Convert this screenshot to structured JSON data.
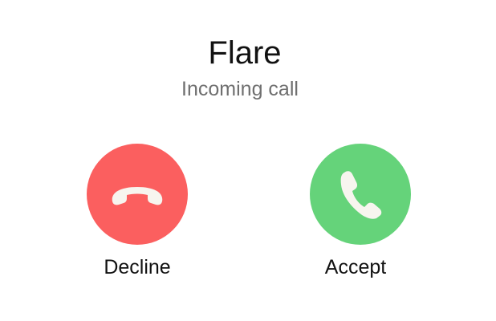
{
  "call": {
    "caller_name": "Flare",
    "status": "Incoming call"
  },
  "actions": {
    "decline": {
      "label": "Decline",
      "icon": "phone-hangup-icon",
      "color": "#fb5f5f"
    },
    "accept": {
      "label": "Accept",
      "icon": "phone-icon",
      "color": "#65d37a"
    }
  },
  "colors": {
    "background": "#ffffff",
    "icon_fill": "#f7f5ef"
  }
}
